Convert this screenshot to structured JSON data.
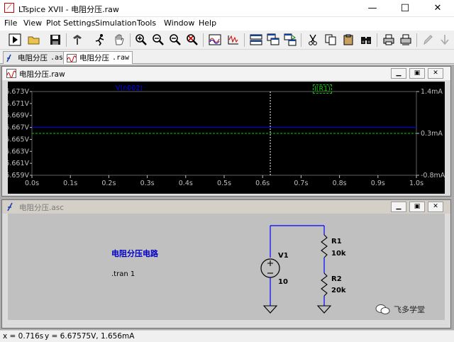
{
  "window": {
    "title": "LTspice XVII - 电阻分压.raw",
    "minimize": "—",
    "maximize": "☐",
    "close": "✕"
  },
  "menu": [
    "File",
    "View",
    "Plot Settings",
    "Simulation",
    "Tools",
    "Window",
    "Help"
  ],
  "toolbar": {
    "icons": [
      "run-icon",
      "open-icon",
      "save-icon",
      "control-panel-icon",
      "halt-icon",
      "pan-icon",
      "zoom-in-icon",
      "zoom-out-icon",
      "zoom-fit-icon",
      "zoom-cancel-icon",
      "autorange-icon",
      "fft-icon",
      "tile-icon",
      "cascade-icon",
      "switch-icon",
      "cut-icon",
      "copy-icon",
      "find-icon",
      "print-icon",
      "print-preview-icon",
      "pencil-icon",
      "down-arrow-icon"
    ]
  },
  "tabs": [
    {
      "label": "电阻分压",
      "ext": ".asc"
    },
    {
      "label": "电阻分压",
      "ext": ".raw"
    }
  ],
  "waveform_window": {
    "title": "电阻分压.raw",
    "trace_v": "V(n002)",
    "trace_i": "I(R1)",
    "colors": {
      "trace_v": "#0000ff",
      "trace_i": "#00cc00",
      "grid": "#606060",
      "cursor": "#ffffff",
      "text": "#bfbfbf"
    }
  },
  "schematic_window": {
    "title": "电阻分压.asc",
    "heading": "电阻分压电路",
    "directive": ".tran 1",
    "v1": {
      "name": "V1",
      "value": "10"
    },
    "r1": {
      "name": "R1",
      "value": "10k"
    },
    "r2": {
      "name": "R2",
      "value": "20k"
    },
    "watermark": "飞多学堂"
  },
  "status": {
    "x": "x = 0.716s",
    "y": "y = 6.67575V, 1.656mA"
  },
  "chart_data": {
    "type": "line",
    "x_ticks": [
      "0.0s",
      "0.1s",
      "0.2s",
      "0.3s",
      "0.4s",
      "0.5s",
      "0.6s",
      "0.7s",
      "0.8s",
      "0.9s",
      "1.0s"
    ],
    "x_values": [
      0.0,
      0.1,
      0.2,
      0.3,
      0.4,
      0.5,
      0.6,
      0.7,
      0.8,
      0.9,
      1.0
    ],
    "xlim": [
      0,
      1.0
    ],
    "y_left_ticks": [
      "6.673V",
      "6.671V",
      "6.669V",
      "6.667V",
      "6.665V",
      "6.663V",
      "6.661V",
      "6.659V"
    ],
    "y_left_values": [
      6.673,
      6.671,
      6.669,
      6.667,
      6.665,
      6.663,
      6.661,
      6.659
    ],
    "ylim_left": [
      6.659,
      6.673
    ],
    "y_right_ticks": [
      "1.4mA",
      "0.3mA",
      "-0.8mA"
    ],
    "y_right_values": [
      1.4,
      0.3,
      -0.8
    ],
    "ylim_right": [
      -0.8,
      1.4
    ],
    "series": [
      {
        "name": "V(n002)",
        "axis": "left",
        "x": [
          0,
          1.0
        ],
        "y": [
          6.667,
          6.667
        ]
      },
      {
        "name": "I(R1)",
        "axis": "right",
        "x": [
          0,
          1.0
        ],
        "y": [
          0.3,
          0.3
        ]
      }
    ],
    "cursor_x": 0.62,
    "grid": true
  }
}
